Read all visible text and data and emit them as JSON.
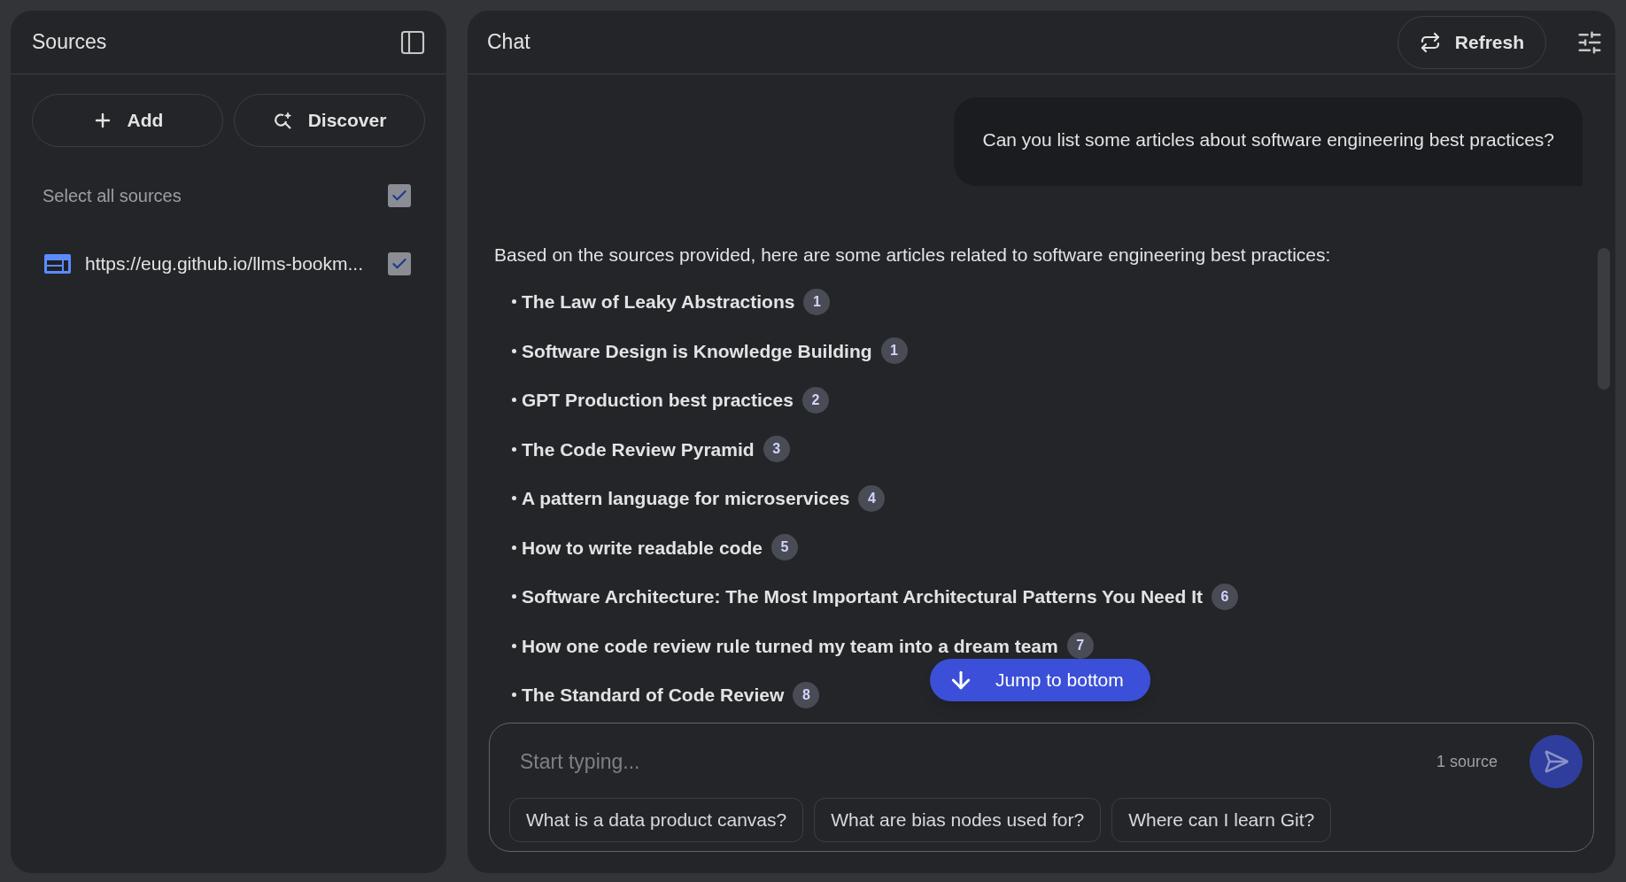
{
  "sources_panel": {
    "title": "Sources",
    "buttons": [
      {
        "kind": "add",
        "label": "Add"
      },
      {
        "kind": "discover",
        "label": "Discover"
      }
    ],
    "select_all": {
      "label": "Select all sources",
      "checked": true
    },
    "items": [
      {
        "label": "https://eug.github.io/llms-bookm...",
        "checked": true
      }
    ]
  },
  "chat": {
    "title": "Chat",
    "refresh_label": "Refresh",
    "user_message": "Can you list some articles about software engineering best practices?",
    "answer_intro": "Based on the sources provided, here are some articles related to software engineering best practices:",
    "articles": [
      {
        "title": "The Law of Leaky Abstractions",
        "citation": "1"
      },
      {
        "title": "Software Design is Knowledge Building",
        "citation": "1"
      },
      {
        "title": "GPT Production best practices",
        "citation": "2"
      },
      {
        "title": "The Code Review Pyramid",
        "citation": "3"
      },
      {
        "title": "A pattern language for microservices",
        "citation": "4"
      },
      {
        "title": "How to write readable code",
        "citation": "5"
      },
      {
        "title": "Software Architecture: The Most Important Architectural Patterns You Need It",
        "citation": "6"
      },
      {
        "title": "How one code review rule turned my team into a dream team",
        "citation": "7"
      },
      {
        "title": "The Standard of Code Review",
        "citation": "8"
      }
    ],
    "jump_label": "Jump to bottom",
    "input": {
      "placeholder": "Start typing...",
      "source_count": "1 source"
    },
    "suggestions": [
      "What is a data product canvas?",
      "What are bias nodes used for?",
      "Where can I learn Git?"
    ]
  }
}
